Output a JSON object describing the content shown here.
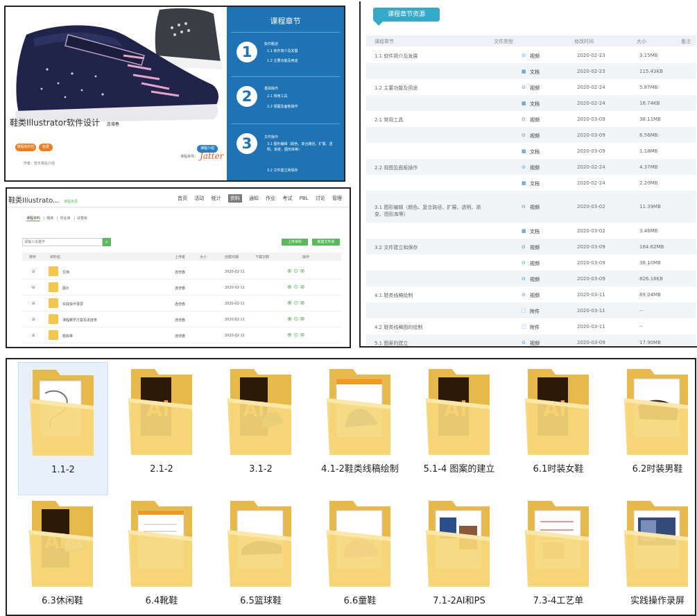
{
  "banner": {
    "course_title": "鞋类Illustrator软件设计",
    "course_sub": "连增春",
    "tag_left_1": "课程资料包",
    "tag_left_2": "免费",
    "meta_line": "作者：暂无相关介绍",
    "teacher_label": "课程讲师：",
    "teacher_sign": "Jatter",
    "teacher_badge": "课程介绍",
    "chapters_title": "课程章节",
    "chapters": [
      {
        "num": "1",
        "name": "软件概述",
        "subs": [
          "1.1  软件简介及发展",
          "1.2  主要功能及用途"
        ]
      },
      {
        "num": "2",
        "name": "基础操作",
        "subs": [
          "2.1  常用工具",
          "2.2  视图及面板操作"
        ]
      },
      {
        "num": "3",
        "name": "文件操作",
        "subs": [
          "3.1  图形编辑（颜色、复合路径、扩展、透明、渐变、图形库等）",
          "3.2  文件建立和保存"
        ]
      }
    ]
  },
  "manage": {
    "app_title": "鞋类Illustrato...",
    "app_tag": "课程资源",
    "nav": [
      "首页",
      "活动",
      "统计",
      "资料",
      "通知",
      "作业",
      "考试",
      "PBL",
      "讨论",
      "管理"
    ],
    "nav_active_index": 3,
    "subtabs": [
      "课程资料",
      "题库",
      "作业库",
      "试卷库"
    ],
    "search_placeholder": "请输入关键字",
    "btn_upload": "上传资料",
    "btn_new_folder": "新建文件夹",
    "headers": [
      "排序",
      "资料名",
      "上传者",
      "大小",
      "创建日期",
      "下载次数",
      "操作"
    ],
    "rows": [
      {
        "name": "文档",
        "owner": "连增春",
        "date": "2020-02-11"
      },
      {
        "name": "图片",
        "owner": "连增春",
        "date": "2020-02-11"
      },
      {
        "name": "实践操作录屏",
        "owner": "连增春",
        "date": "2020-02-11"
      },
      {
        "name": "课程教学方案及进度表",
        "owner": "连增春",
        "date": "2020-02-11"
      },
      {
        "name": "题库等",
        "owner": "连增春",
        "date": "2020-02-11"
      }
    ]
  },
  "resources": {
    "tab_label": "课程章节资源",
    "headers": [
      "课程章节",
      "文件类型",
      "修改时间",
      "大小",
      "备注"
    ],
    "rows": [
      {
        "chapter": "1.1 软件简介及发展",
        "type": "视频",
        "date": "2020-02-23",
        "size": "3.15MB"
      },
      {
        "chapter": "",
        "type": "文档",
        "date": "2020-02-23",
        "size": "115.43KB"
      },
      {
        "chapter": "1.2 主要功能及用途",
        "type": "视频",
        "date": "2020-02-24",
        "size": "5.87MB"
      },
      {
        "chapter": "",
        "type": "文档",
        "date": "2020-02-24",
        "size": "16.74KB"
      },
      {
        "chapter": "2.1 常用工具",
        "type": "视频",
        "date": "2020-03-09",
        "size": "38.11MB"
      },
      {
        "chapter": "",
        "type": "视频",
        "date": "2020-03-09",
        "size": "6.56MB"
      },
      {
        "chapter": "",
        "type": "文档",
        "date": "2020-03-09",
        "size": "1.18MB"
      },
      {
        "chapter": "2.2 视图及面板操作",
        "type": "视频",
        "date": "2020-02-24",
        "size": "4.37MB"
      },
      {
        "chapter": "",
        "type": "文档",
        "date": "2020-02-24",
        "size": "2.20MB"
      },
      {
        "chapter": "3.1 图形编辑（颜色、复合路径、扩展、透明、渐变、图形库等）",
        "type": "视频",
        "date": "2020-03-02",
        "size": "11.39MB"
      },
      {
        "chapter": "",
        "type": "文档",
        "date": "2020-03-02",
        "size": "3.46MB"
      },
      {
        "chapter": "3.2 文件建立和保存",
        "type": "视频",
        "date": "2020-03-09",
        "size": "164.62MB"
      },
      {
        "chapter": "",
        "type": "视频",
        "date": "2020-03-09",
        "size": "38.10MB"
      },
      {
        "chapter": "",
        "type": "视频",
        "date": "2020-03-09",
        "size": "826.18KB"
      },
      {
        "chapter": "4.1 鞋类线稿绘制",
        "type": "视频",
        "date": "2020-03-11",
        "size": "89.04MB"
      },
      {
        "chapter": "",
        "type": "附件",
        "date": "2020-03-11",
        "size": "--"
      },
      {
        "chapter": "4.2 鞋类线稿图的绘制",
        "type": "附件",
        "date": "2020-03-11",
        "size": "--"
      },
      {
        "chapter": "5.1 图案的建立",
        "type": "视频",
        "date": "2020-03-09",
        "size": "17.90MB"
      }
    ]
  },
  "folders": {
    "items": [
      {
        "label": "1.1-2",
        "thumb": "sketch"
      },
      {
        "label": "2.1-2",
        "thumb": "ai"
      },
      {
        "label": "3.1-2",
        "thumb": "ai-shoe"
      },
      {
        "label": "4.1-2鞋类线稿绘制",
        "thumb": "shoe-blue"
      },
      {
        "label": "5.1-4 图案的建立",
        "thumb": "ai"
      },
      {
        "label": "6.1时装女鞋",
        "thumb": "ai"
      },
      {
        "label": "6.2时装男鞋",
        "thumb": "shoe-dark"
      },
      {
        "label": "6.3休闲鞋",
        "thumb": "ai-sneaker"
      },
      {
        "label": "6.4靴鞋",
        "thumb": "doc"
      },
      {
        "label": "6.5篮球鞋",
        "thumb": "sneaker"
      },
      {
        "label": "6.6童鞋",
        "thumb": "shoe-pink"
      },
      {
        "label": "7.1-2AI和PS",
        "thumb": "doc-photo"
      },
      {
        "label": "7.3-4工艺单",
        "thumb": "doc-red"
      },
      {
        "label": "实践操作录屏",
        "thumb": "screen"
      }
    ],
    "selected_index": 0
  },
  "colors": {
    "accent_blue": "#1d73b3",
    "teal_tab": "#35a9c8",
    "green_btn": "#5cb85c",
    "orange_tag": "#f07b1d",
    "folder": "#f1cc62"
  }
}
